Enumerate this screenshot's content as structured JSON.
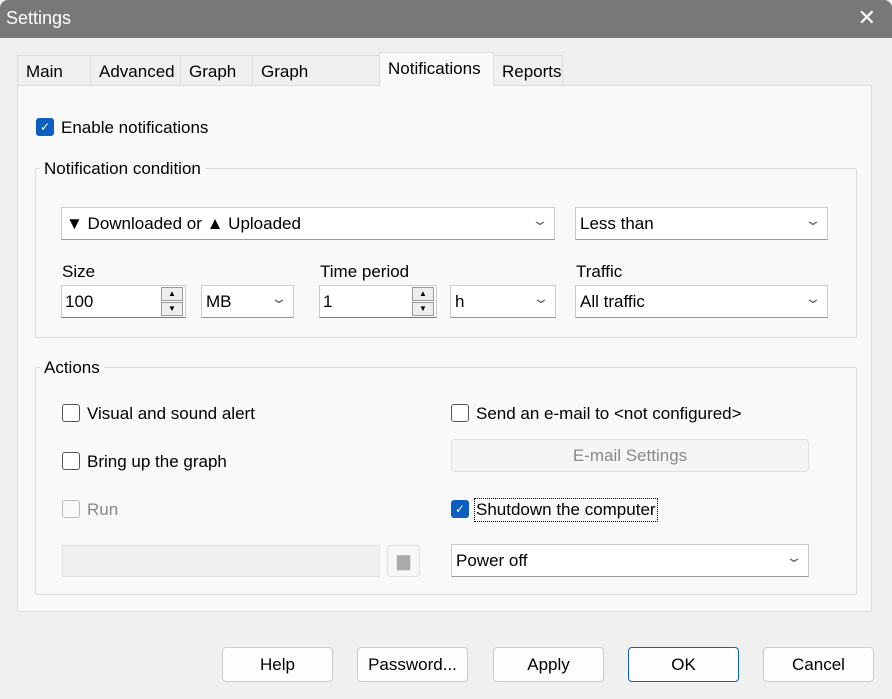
{
  "window": {
    "title": "Settings",
    "close_icon": "close-icon"
  },
  "tabs": [
    {
      "label": "Main"
    },
    {
      "label": "Advanced"
    },
    {
      "label": "Graph"
    },
    {
      "label": "Graph Colours"
    },
    {
      "label": "Notifications",
      "active": true
    },
    {
      "label": "Reports"
    }
  ],
  "enable_notifications": {
    "label": "Enable notifications",
    "checked": true
  },
  "condition": {
    "legend": "Notification condition",
    "direction": "▼ Downloaded or ▲ Uploaded",
    "comparison": "Less than",
    "size_label": "Size",
    "size_value": "100",
    "size_unit": "MB",
    "period_label": "Time period",
    "period_value": "1",
    "period_unit": "h",
    "traffic_label": "Traffic",
    "traffic_value": "All traffic"
  },
  "actions": {
    "legend": "Actions",
    "visual_alert": {
      "label": "Visual and sound alert",
      "checked": false
    },
    "bring_graph": {
      "label": "Bring up the graph",
      "checked": false
    },
    "run": {
      "label": "Run",
      "checked": false,
      "disabled": true
    },
    "run_path": "",
    "email": {
      "label": "Send an e-mail to <not configured>",
      "checked": false
    },
    "email_settings": "E-mail Settings",
    "shutdown": {
      "label": "Shutdown the computer",
      "checked": true
    },
    "shutdown_mode": "Power off"
  },
  "buttons": {
    "help": "Help",
    "password": "Password...",
    "apply": "Apply",
    "ok": "OK",
    "cancel": "Cancel"
  },
  "colors": {
    "accent": "#0a5fc0",
    "titlebar": "#787878"
  }
}
